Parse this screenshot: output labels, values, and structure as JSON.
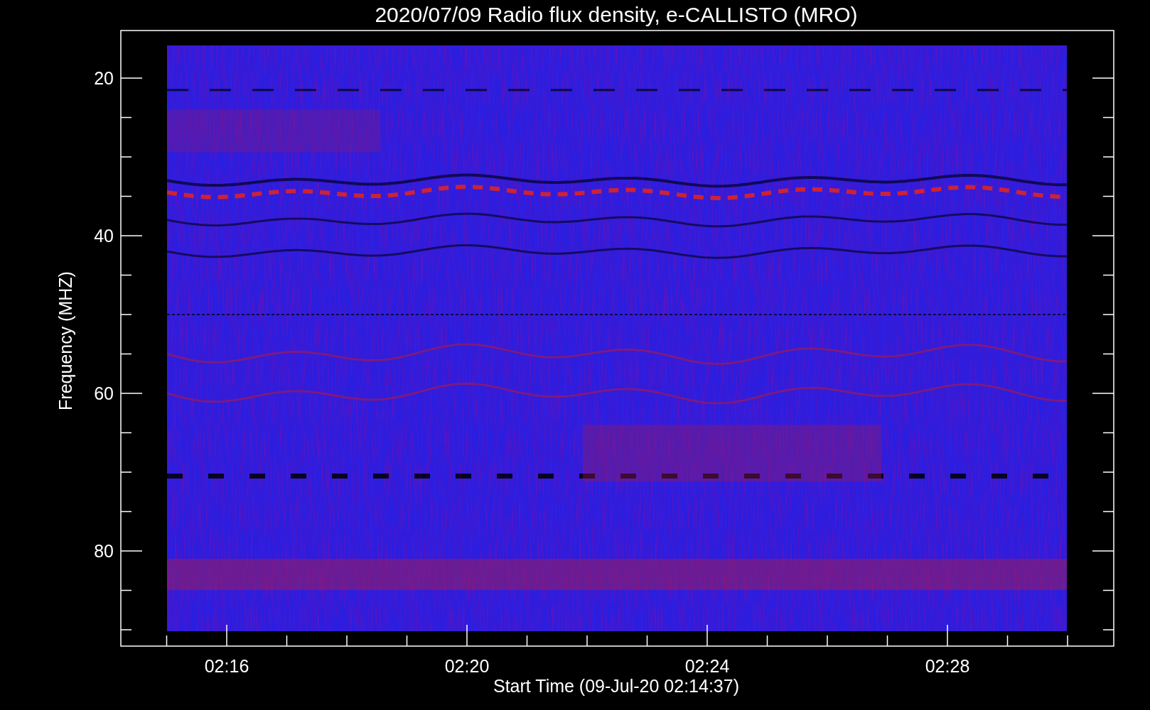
{
  "title": "2020/07/09  Radio flux density, e-CALLISTO (MRO)",
  "y_axis": {
    "label": "Frequency (MHZ)",
    "tick_labels": [
      "20",
      "40",
      "60",
      "80"
    ]
  },
  "x_axis": {
    "label": "Start Time (09-Jul-20 02:14:37)",
    "tick_labels": [
      "02:16",
      "02:20",
      "02:24",
      "02:28"
    ]
  }
}
